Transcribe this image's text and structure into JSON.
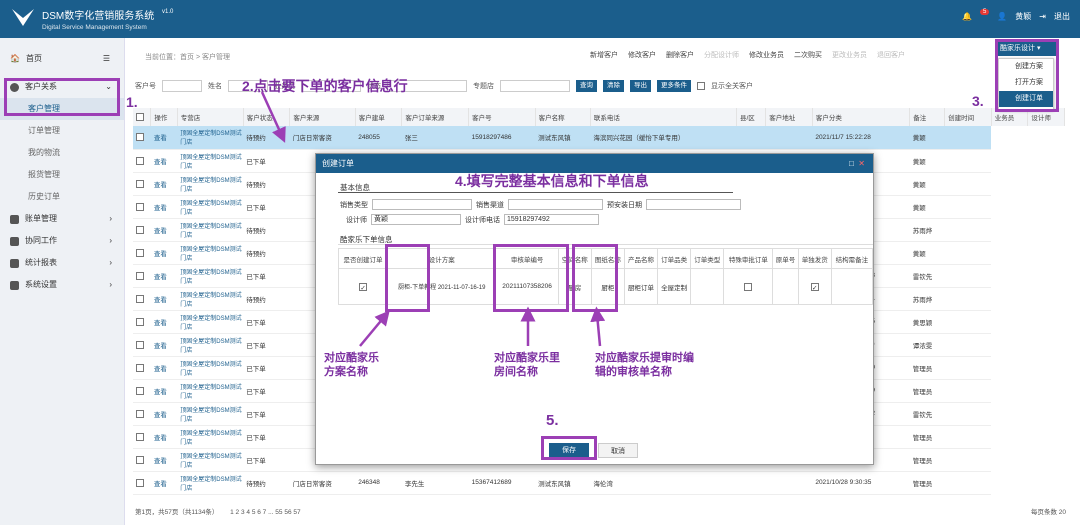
{
  "app": {
    "title": "DSM数字化营销服务系统",
    "subtitle": "Digital Service Management System",
    "version": "v1.0",
    "notif_count": "5",
    "user": "黄颖",
    "logout": "退出"
  },
  "sidebar": {
    "home": "首页",
    "groups": [
      {
        "label": "客户关系"
      },
      {
        "label": "账单管理"
      },
      {
        "label": "协同工作"
      },
      {
        "label": "统计报表"
      },
      {
        "label": "系统设置"
      }
    ],
    "subs": [
      "客户管理",
      "订单管理",
      "我的物流",
      "报货管理",
      "历史订单"
    ]
  },
  "breadcrumb": "当前位置：首页 > 客户管理",
  "toolbar": [
    "新增客户",
    "修改客户",
    "删除客户",
    "分配设计师",
    "修改业务员",
    "二次购买",
    "更改业务员",
    "退回客户"
  ],
  "dropdown": {
    "button": "酷家乐设计",
    "items": [
      "创建方案",
      "打开方案",
      "创建订单"
    ]
  },
  "search": {
    "labels": [
      "客户号",
      "姓名",
      "业务员",
      "状态",
      "专题店"
    ],
    "buttons": [
      "查询",
      "清除",
      "导出",
      "更多条件"
    ],
    "check": "显示全关客户"
  },
  "grid": {
    "headers": [
      "",
      "操作",
      "专营店",
      "客户状态",
      "客户来源",
      "客户建单",
      "客户订单来源",
      "客户号",
      "客户名称",
      "联系电话",
      "县/区",
      "客户地址",
      "客户分类",
      "备注",
      "创建时间",
      "业务员",
      "设计师"
    ],
    "rows": [
      [
        "查看",
        "顶固全屋定制DSM测试门店",
        "待预约",
        "",
        "",
        "门店日常客资",
        "248055",
        "张三",
        "15918297486",
        "测试东风镇",
        "海滨同兴花园（缓怡下单专用）",
        "",
        "",
        "2021/11/7 15:22:28",
        "黄颖"
      ],
      [
        "查看",
        "顶固全屋定制DSM测试门店",
        "已下单",
        "",
        "",
        "",
        "",
        "",
        "",
        "",
        "",
        "",
        "",
        "2021/11/6 16:51:36",
        "黄颖"
      ],
      [
        "查看",
        "顶固全屋定制DSM测试门店",
        "待预约",
        "",
        "",
        "",
        "",
        "",
        "",
        "",
        "",
        "",
        "",
        "2021/11/6 16:13:27",
        "黄颖"
      ],
      [
        "查看",
        "顶固全屋定制DSM测试门店",
        "已下单",
        "",
        "",
        "",
        "",
        "",
        "",
        "",
        "",
        "",
        "",
        "2021/11/6 16:00:24",
        "黄颖"
      ],
      [
        "查看",
        "顶固全屋定制DSM测试门店",
        "待预约",
        "",
        "",
        "",
        "",
        "",
        "",
        "",
        "",
        "",
        "",
        "2021/11/3 16:43:01",
        "苏雨烨"
      ],
      [
        "查看",
        "顶固全屋定制DSM测试门店",
        "待预约",
        "",
        "",
        "",
        "",
        "",
        "",
        "",
        "",
        "",
        "",
        "2021/11/1 11:55:09",
        "黄颖"
      ],
      [
        "查看",
        "顶固全屋定制DSM测试门店",
        "已下单",
        "",
        "",
        "",
        "",
        "",
        "",
        "",
        "",
        "",
        "",
        "2021/10/31 15:51:23",
        "雷钦先"
      ],
      [
        "查看",
        "顶固全屋定制DSM测试门店",
        "待预约",
        "",
        "",
        "",
        "",
        "",
        "",
        "",
        "",
        "",
        "",
        "2021/10/29 13:07:01",
        "苏雨烨"
      ],
      [
        "查看",
        "顶固全屋定制DSM测试门店",
        "已下单",
        "",
        "",
        "",
        "",
        "",
        "",
        "",
        "",
        "",
        "",
        "2021/10/28 16:15:45",
        "黄思颖"
      ],
      [
        "查看",
        "顶固全屋定制DSM测试门店",
        "已下单",
        "",
        "",
        "",
        "",
        "",
        "",
        "",
        "",
        "",
        "",
        "2021/10/28 11:33:10",
        "谭浓雯"
      ],
      [
        "查看",
        "顶固全屋定制DSM测试门店",
        "已下单",
        "",
        "",
        "",
        "",
        "",
        "",
        "",
        "",
        "",
        "",
        "2021/10/28 10:07:50",
        "管理员"
      ],
      [
        "查看",
        "顶固全屋定制DSM测试门店",
        "已下单",
        "",
        "",
        "",
        "",
        "",
        "",
        "",
        "",
        "",
        "",
        "2021/10/28 10:06:09",
        "管理员"
      ],
      [
        "查看",
        "顶固全屋定制DSM测试门店",
        "已下单",
        "",
        "",
        "",
        "",
        "",
        "",
        "",
        "",
        "",
        "",
        "2021/10/28 10:02:12",
        "雷钦先"
      ],
      [
        "查看",
        "顶固全屋定制DSM测试门店",
        "已下单",
        "",
        "",
        "",
        "",
        "",
        "",
        "",
        "",
        "",
        "",
        "2021/10/28 9:43:07",
        "管理员"
      ],
      [
        "查看",
        "顶固全屋定制DSM测试门店",
        "已下单",
        "",
        "",
        "",
        "",
        "",
        "",
        "",
        "",
        "",
        "",
        "2021/10/28 9:32:56",
        "管理员"
      ],
      [
        "查看",
        "顶固全屋定制DSM测试门店",
        "待预约",
        "",
        "",
        "门店日常客资",
        "246348",
        "李先生",
        "15367412689",
        "测试东风镇",
        "海伦湾",
        "",
        "",
        "2021/10/28 9:30:35",
        "管理员"
      ]
    ]
  },
  "pager": {
    "left": "第1页，共57页（共1134条）",
    "pages": "1 2 3 4 5 6 7 ... 55 56 57",
    "right": "每页条数 20"
  },
  "modal": {
    "title": "创建订单",
    "basic": "基本信息",
    "sales_type": "销售类型",
    "channel": "销售渠道",
    "preinstall": "预安装日期",
    "designer": "设计师",
    "designer_val": "黄颖",
    "designer_phone": "设计师电话",
    "phone_val": "15918297492",
    "kujiale": "酷家乐下单信息",
    "cols": [
      "是否创建订单",
      "设计方案",
      "审核单编号",
      "空间名称",
      "图纸名称",
      "产品名称",
      "订单品类",
      "订单类型",
      "特殊审批订单",
      "原单号",
      "单独发货",
      "结构需备注"
    ],
    "row": {
      "plan": "厨柜-下单教程 2021-11-07-16-19",
      "code": "20211107358206",
      "space": "厨房",
      "drawing": "厨柜",
      "product": "厨柜订单",
      "category": "全屋定制"
    },
    "save": "保存",
    "cancel": "取消"
  },
  "annotations": {
    "a1": "1.",
    "a2": "2.点击要下单的客户信息行",
    "a3": "3.",
    "a4": "4.填写完整基本信息和下单信息",
    "a5": "5.",
    "n1": "对应酷家乐方案名称",
    "n2": "对应酷家乐里房间名称",
    "n3": "对应酷家乐提审时编辑的审核单名称"
  },
  "colors": {
    "primary": "#1b5e8c",
    "annotation": "#9c3fb5",
    "selected": "#bfe0f4"
  }
}
